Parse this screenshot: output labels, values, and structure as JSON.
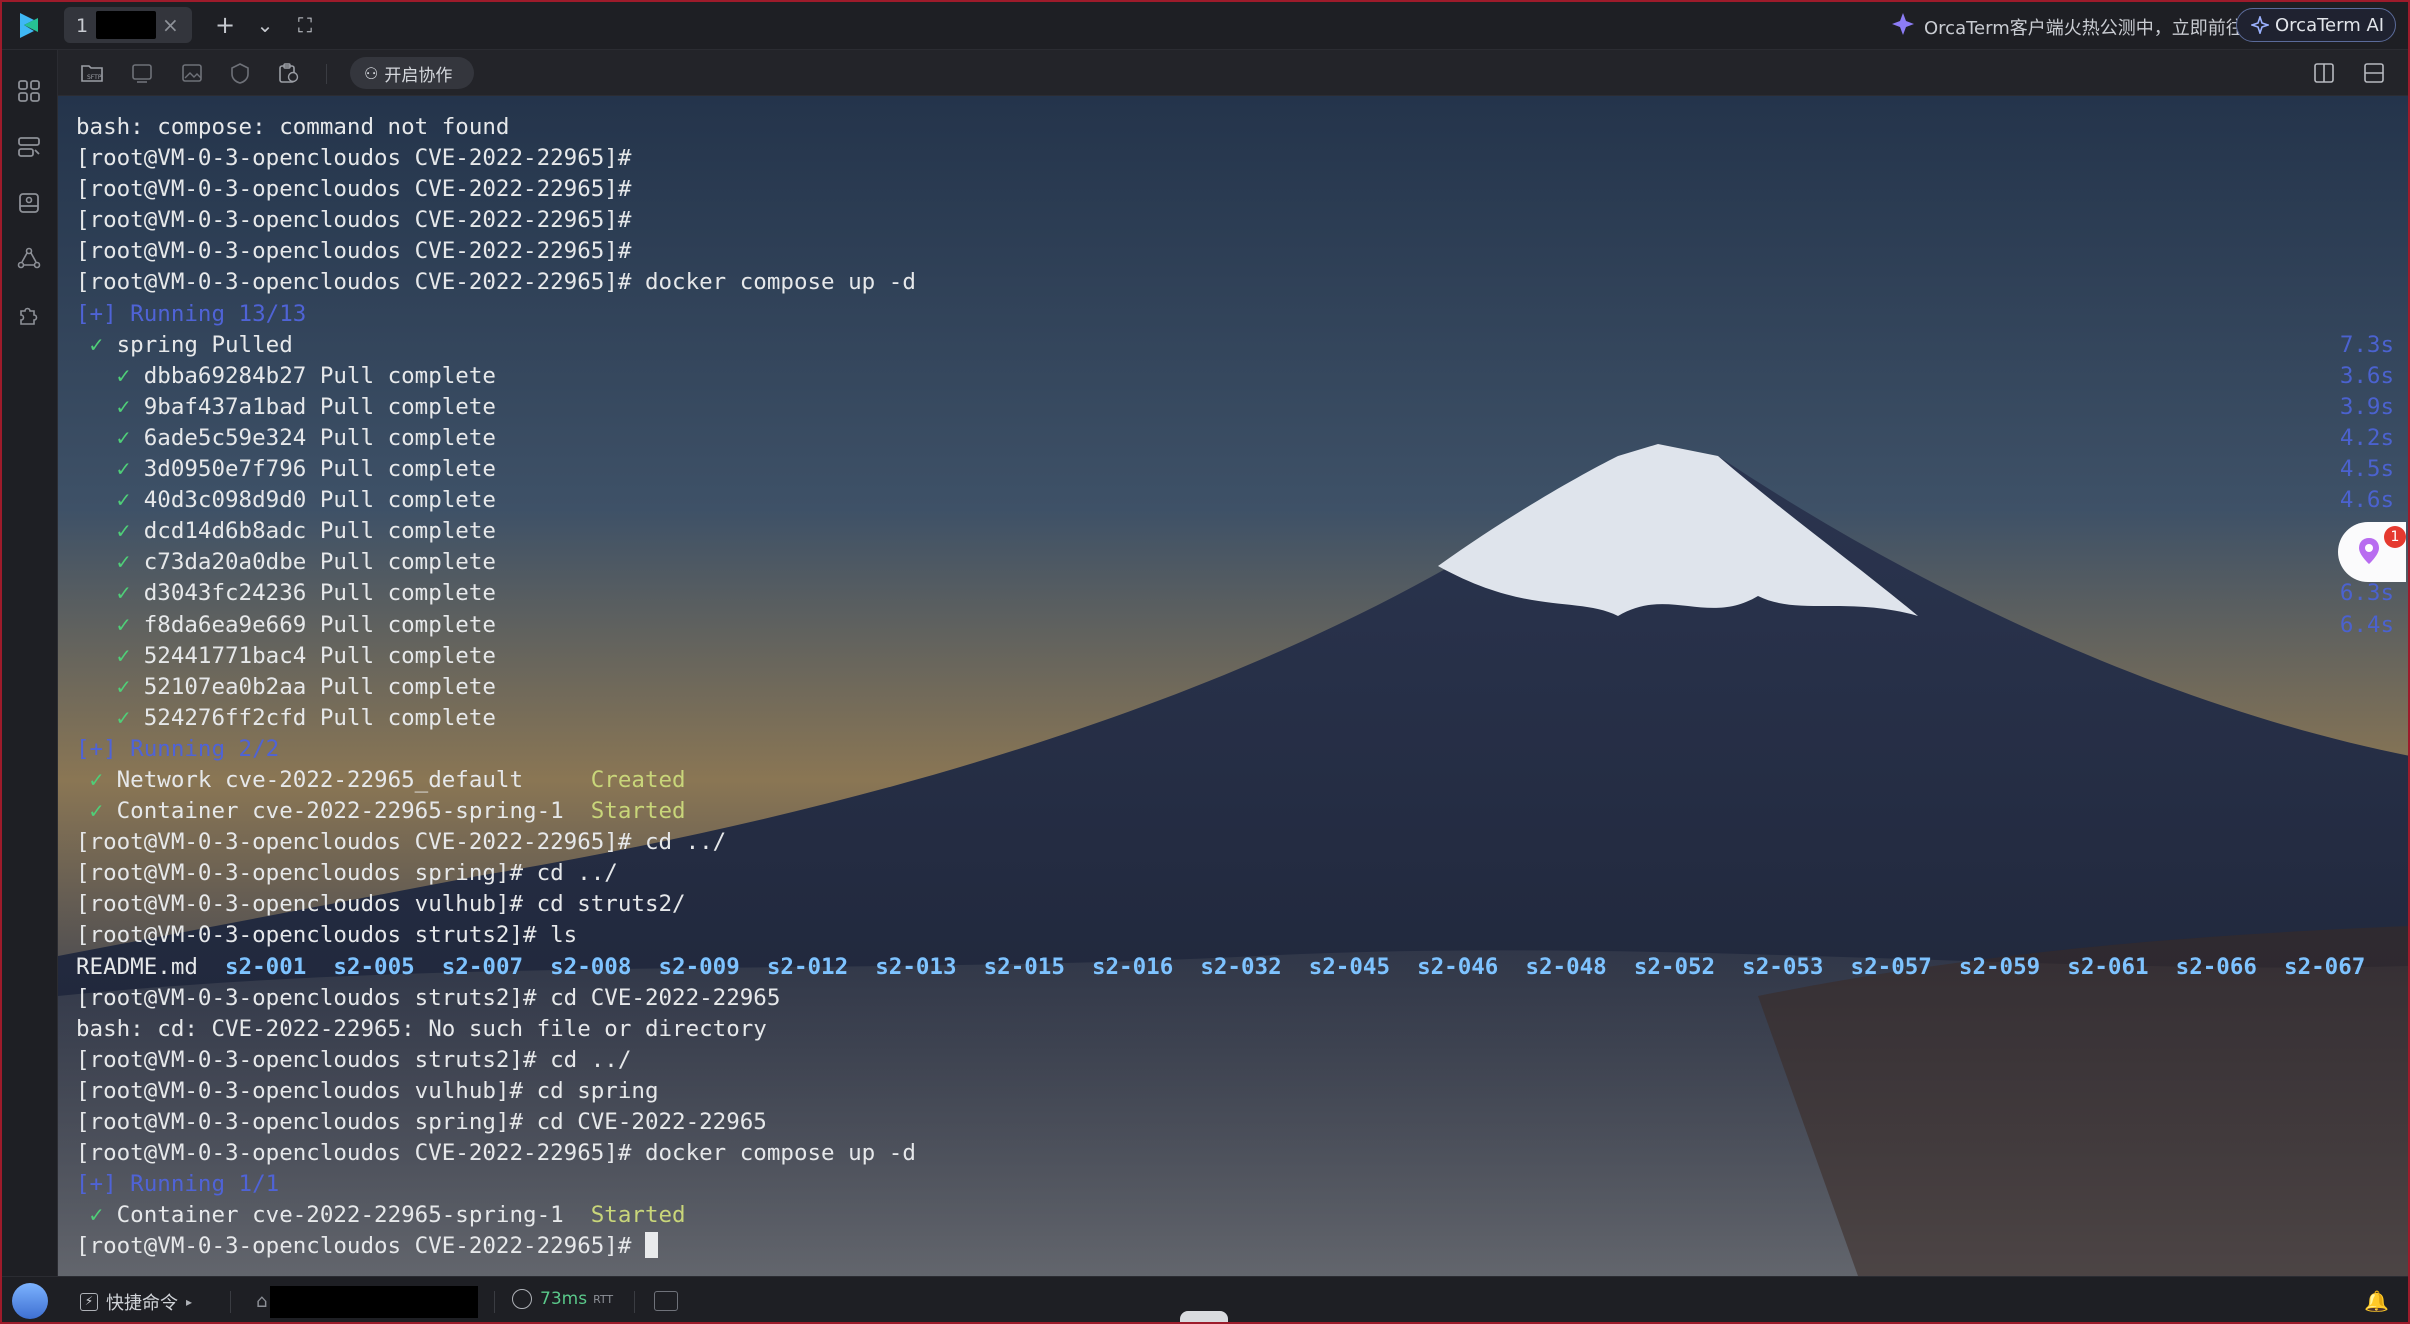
{
  "titlebar": {
    "tab_number": "1",
    "tab_close": "×",
    "new_tab": "+",
    "dropdown": "⌄",
    "fullscreen": "⛶",
    "promo_text": "OrcaTerm客户端火热公测中，立即前往",
    "ai_button_label": "OrcaTerm AI"
  },
  "toolbar": {
    "collab_label": "开启协作"
  },
  "terminal": {
    "lines": [
      {
        "text": "bash: compose: command not found"
      },
      {
        "text": "[root@VM-0-3-opencloudos CVE-2022-22965]#"
      },
      {
        "text": "[root@VM-0-3-opencloudos CVE-2022-22965]#"
      },
      {
        "text": "[root@VM-0-3-opencloudos CVE-2022-22965]#"
      },
      {
        "text": "[root@VM-0-3-opencloudos CVE-2022-22965]#"
      },
      {
        "text": "[root@VM-0-3-opencloudos CVE-2022-22965]# docker compose up -d"
      },
      {
        "text": "[+] Running 13/13",
        "style": "blue"
      },
      {
        "check": " ✓",
        "text": " spring Pulled"
      },
      {
        "check": "   ✓",
        "text": " dbba69284b27 Pull complete"
      },
      {
        "check": "   ✓",
        "text": " 9baf437a1bad Pull complete"
      },
      {
        "check": "   ✓",
        "text": " 6ade5c59e324 Pull complete"
      },
      {
        "check": "   ✓",
        "text": " 3d0950e7f796 Pull complete"
      },
      {
        "check": "   ✓",
        "text": " 40d3c098d9d0 Pull complete"
      },
      {
        "check": "   ✓",
        "text": " dcd14d6b8adc Pull complete"
      },
      {
        "check": "   ✓",
        "text": " c73da20a0dbe Pull complete"
      },
      {
        "check": "   ✓",
        "text": " d3043fc24236 Pull complete"
      },
      {
        "check": "   ✓",
        "text": " f8da6ea9e669 Pull complete"
      },
      {
        "check": "   ✓",
        "text": " 52441771bac4 Pull complete"
      },
      {
        "check": "   ✓",
        "text": " 52107ea0b2aa Pull complete"
      },
      {
        "check": "   ✓",
        "text": " 524276ff2cfd Pull complete"
      },
      {
        "text": "[+] Running 2/2",
        "style": "blue"
      },
      {
        "check": " ✓",
        "text": " Network cve-2022-22965_default     ",
        "status": "Created"
      },
      {
        "check": " ✓",
        "text": " Container cve-2022-22965-spring-1  ",
        "status": "Started"
      },
      {
        "text": "[root@VM-0-3-opencloudos CVE-2022-22965]# cd ../"
      },
      {
        "text": "[root@VM-0-3-opencloudos spring]# cd ../"
      },
      {
        "text": "[root@VM-0-3-opencloudos vulhub]# cd struts2/"
      },
      {
        "text": "[root@VM-0-3-opencloudos struts2]# ls"
      },
      {
        "text": "README.md  ",
        "dirs": "s2-001  s2-005  s2-007  s2-008  s2-009  s2-012  s2-013  s2-015  s2-016  s2-032  s2-045  s2-046  s2-048  s2-052  s2-053  s2-057  s2-059  s2-061  s2-066  s2-067"
      },
      {
        "text": "[root@VM-0-3-opencloudos struts2]# cd CVE-2022-22965"
      },
      {
        "text": "bash: cd: CVE-2022-22965: No such file or directory"
      },
      {
        "text": "[root@VM-0-3-opencloudos struts2]# cd ../"
      },
      {
        "text": "[root@VM-0-3-opencloudos vulhub]# cd spring"
      },
      {
        "text": "[root@VM-0-3-opencloudos spring]# cd CVE-2022-22965"
      },
      {
        "text": "[root@VM-0-3-opencloudos CVE-2022-22965]# docker compose up -d"
      },
      {
        "text": "[+] Running 1/1",
        "style": "blue"
      },
      {
        "check": " ✓",
        "text": " Container cve-2022-22965-spring-1  ",
        "status": "Started"
      },
      {
        "text": "[root@VM-0-3-opencloudos CVE-2022-22965]# ",
        "cursor": true
      }
    ],
    "timings": [
      "7.3s",
      "3.6s",
      "3.9s",
      "4.2s",
      "4.5s",
      "4.6s",
      "",
      "6.3s",
      "6.3s",
      "6.4s"
    ]
  },
  "widget": {
    "badge_count": "1"
  },
  "statusbar": {
    "quick_cmd_label": "快捷命令",
    "latency": "73ms",
    "latency_unit": "RTT"
  }
}
